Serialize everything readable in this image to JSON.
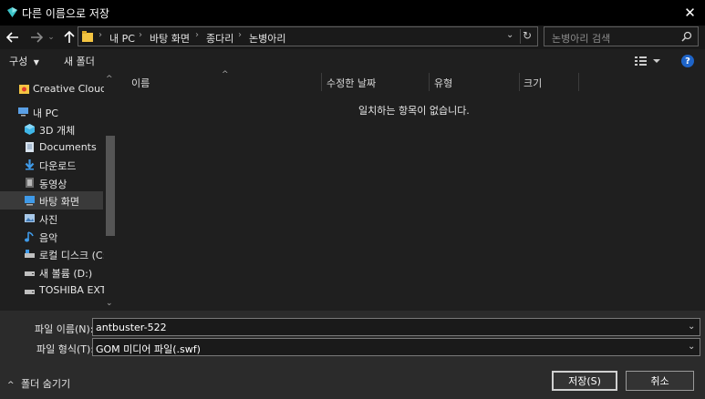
{
  "window": {
    "title": "다른 이름으로 저장"
  },
  "address": {
    "crumbs": [
      "내 PC",
      "바탕 화면",
      "종다리",
      "논병아리"
    ],
    "search_placeholder": "논병아리 검색"
  },
  "toolbar": {
    "organize_label": "구성",
    "new_folder_label": "새 폴더"
  },
  "nav": {
    "items": [
      {
        "label": "Creative Cloud Fil",
        "icon": "creative-cloud-files-icon"
      },
      {
        "label": "내 PC",
        "icon": "computer-icon"
      },
      {
        "label": "3D 개체",
        "icon": "3d-objects-icon"
      },
      {
        "label": "Documents",
        "icon": "documents-icon"
      },
      {
        "label": "다운로드",
        "icon": "download-icon"
      },
      {
        "label": "동영상",
        "icon": "video-icon"
      },
      {
        "label": "바탕 화면",
        "icon": "desktop-icon"
      },
      {
        "label": "사진",
        "icon": "pictures-icon"
      },
      {
        "label": "음악",
        "icon": "music-icon"
      },
      {
        "label": "로컬 디스크 (C:)",
        "icon": "drive-icon"
      },
      {
        "label": "새 볼륨 (D:)",
        "icon": "drive-icon"
      },
      {
        "label": "TOSHIBA EXT (G",
        "icon": "drive-icon"
      }
    ],
    "selected_index": 6
  },
  "filelist": {
    "columns": [
      "이름",
      "수정한 날짜",
      "유형",
      "크기"
    ],
    "empty_message": "일치하는 항목이 없습니다."
  },
  "form": {
    "filename_label": "파일 이름(N):",
    "filename_value": "antbuster-522",
    "filetype_label": "파일 형식(T):",
    "filetype_value": "GOM 미디어 파일(.swf)"
  },
  "footer": {
    "hide_folders_label": "폴더 숨기기",
    "save_label": "저장(S)",
    "cancel_label": "취소"
  },
  "colors": {
    "accent": "#1e64c8",
    "folder": "#f4c542",
    "background": "#1f1f1f"
  }
}
